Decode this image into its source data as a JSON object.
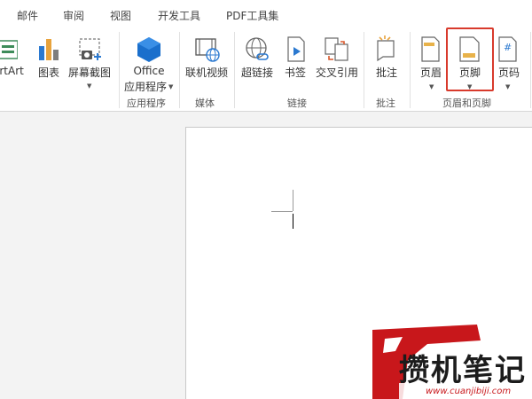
{
  "tabs": [
    "邮件",
    "审阅",
    "视图",
    "开发工具",
    "PDF工具集"
  ],
  "ribbon": {
    "groups": {
      "apps": "应用程序",
      "media": "媒体",
      "links": "链接",
      "comments": "批注",
      "header_footer": "页眉和页脚"
    },
    "buttons": {
      "smartart": "artArt",
      "chart": "图表",
      "screenshot": "屏幕截图",
      "office_apps_line1": "Office",
      "office_apps_line2": "应用程序",
      "online_video": "联机视频",
      "hyperlink": "超链接",
      "bookmark": "书签",
      "cross_reference": "交叉引用",
      "comment": "批注",
      "header": "页眉",
      "footer": "页脚",
      "page_number": "页码"
    },
    "highlighted": "footer"
  },
  "watermark": {
    "text": "攒机笔记",
    "url": "www.cuanjibiji.com"
  },
  "colors": {
    "accent_blue": "#2b79d0",
    "highlight_red": "#d83a2c",
    "watermark_red": "#c8171b"
  }
}
